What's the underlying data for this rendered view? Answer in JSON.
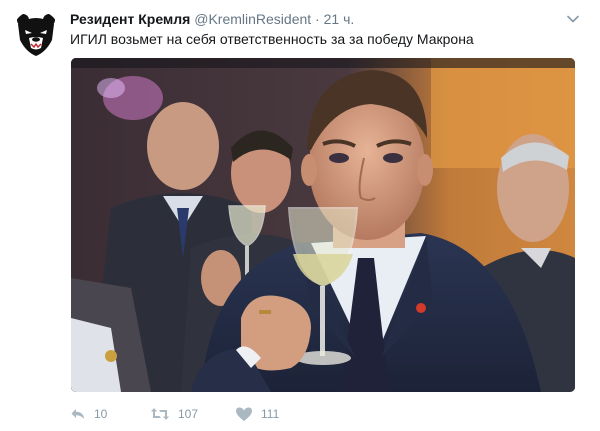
{
  "tweet": {
    "author_name": "Резидент Кремля",
    "author_handle": "@KremlinResident",
    "separator": "·",
    "time": "21 ч.",
    "text": "ИГИЛ возьмет на себя ответственность за за победу Макрона",
    "avatar_icon": "bear-avatar-icon",
    "menu_icon": "chevron-down-icon"
  },
  "actions": {
    "reply": {
      "icon": "reply-icon",
      "count": "10"
    },
    "retweet": {
      "icon": "retweet-icon",
      "count": "107"
    },
    "like": {
      "icon": "heart-icon",
      "count": "111"
    }
  },
  "colors": {
    "text": "#14171a",
    "secondary": "#657786",
    "action_icon": "#aab8c2"
  }
}
